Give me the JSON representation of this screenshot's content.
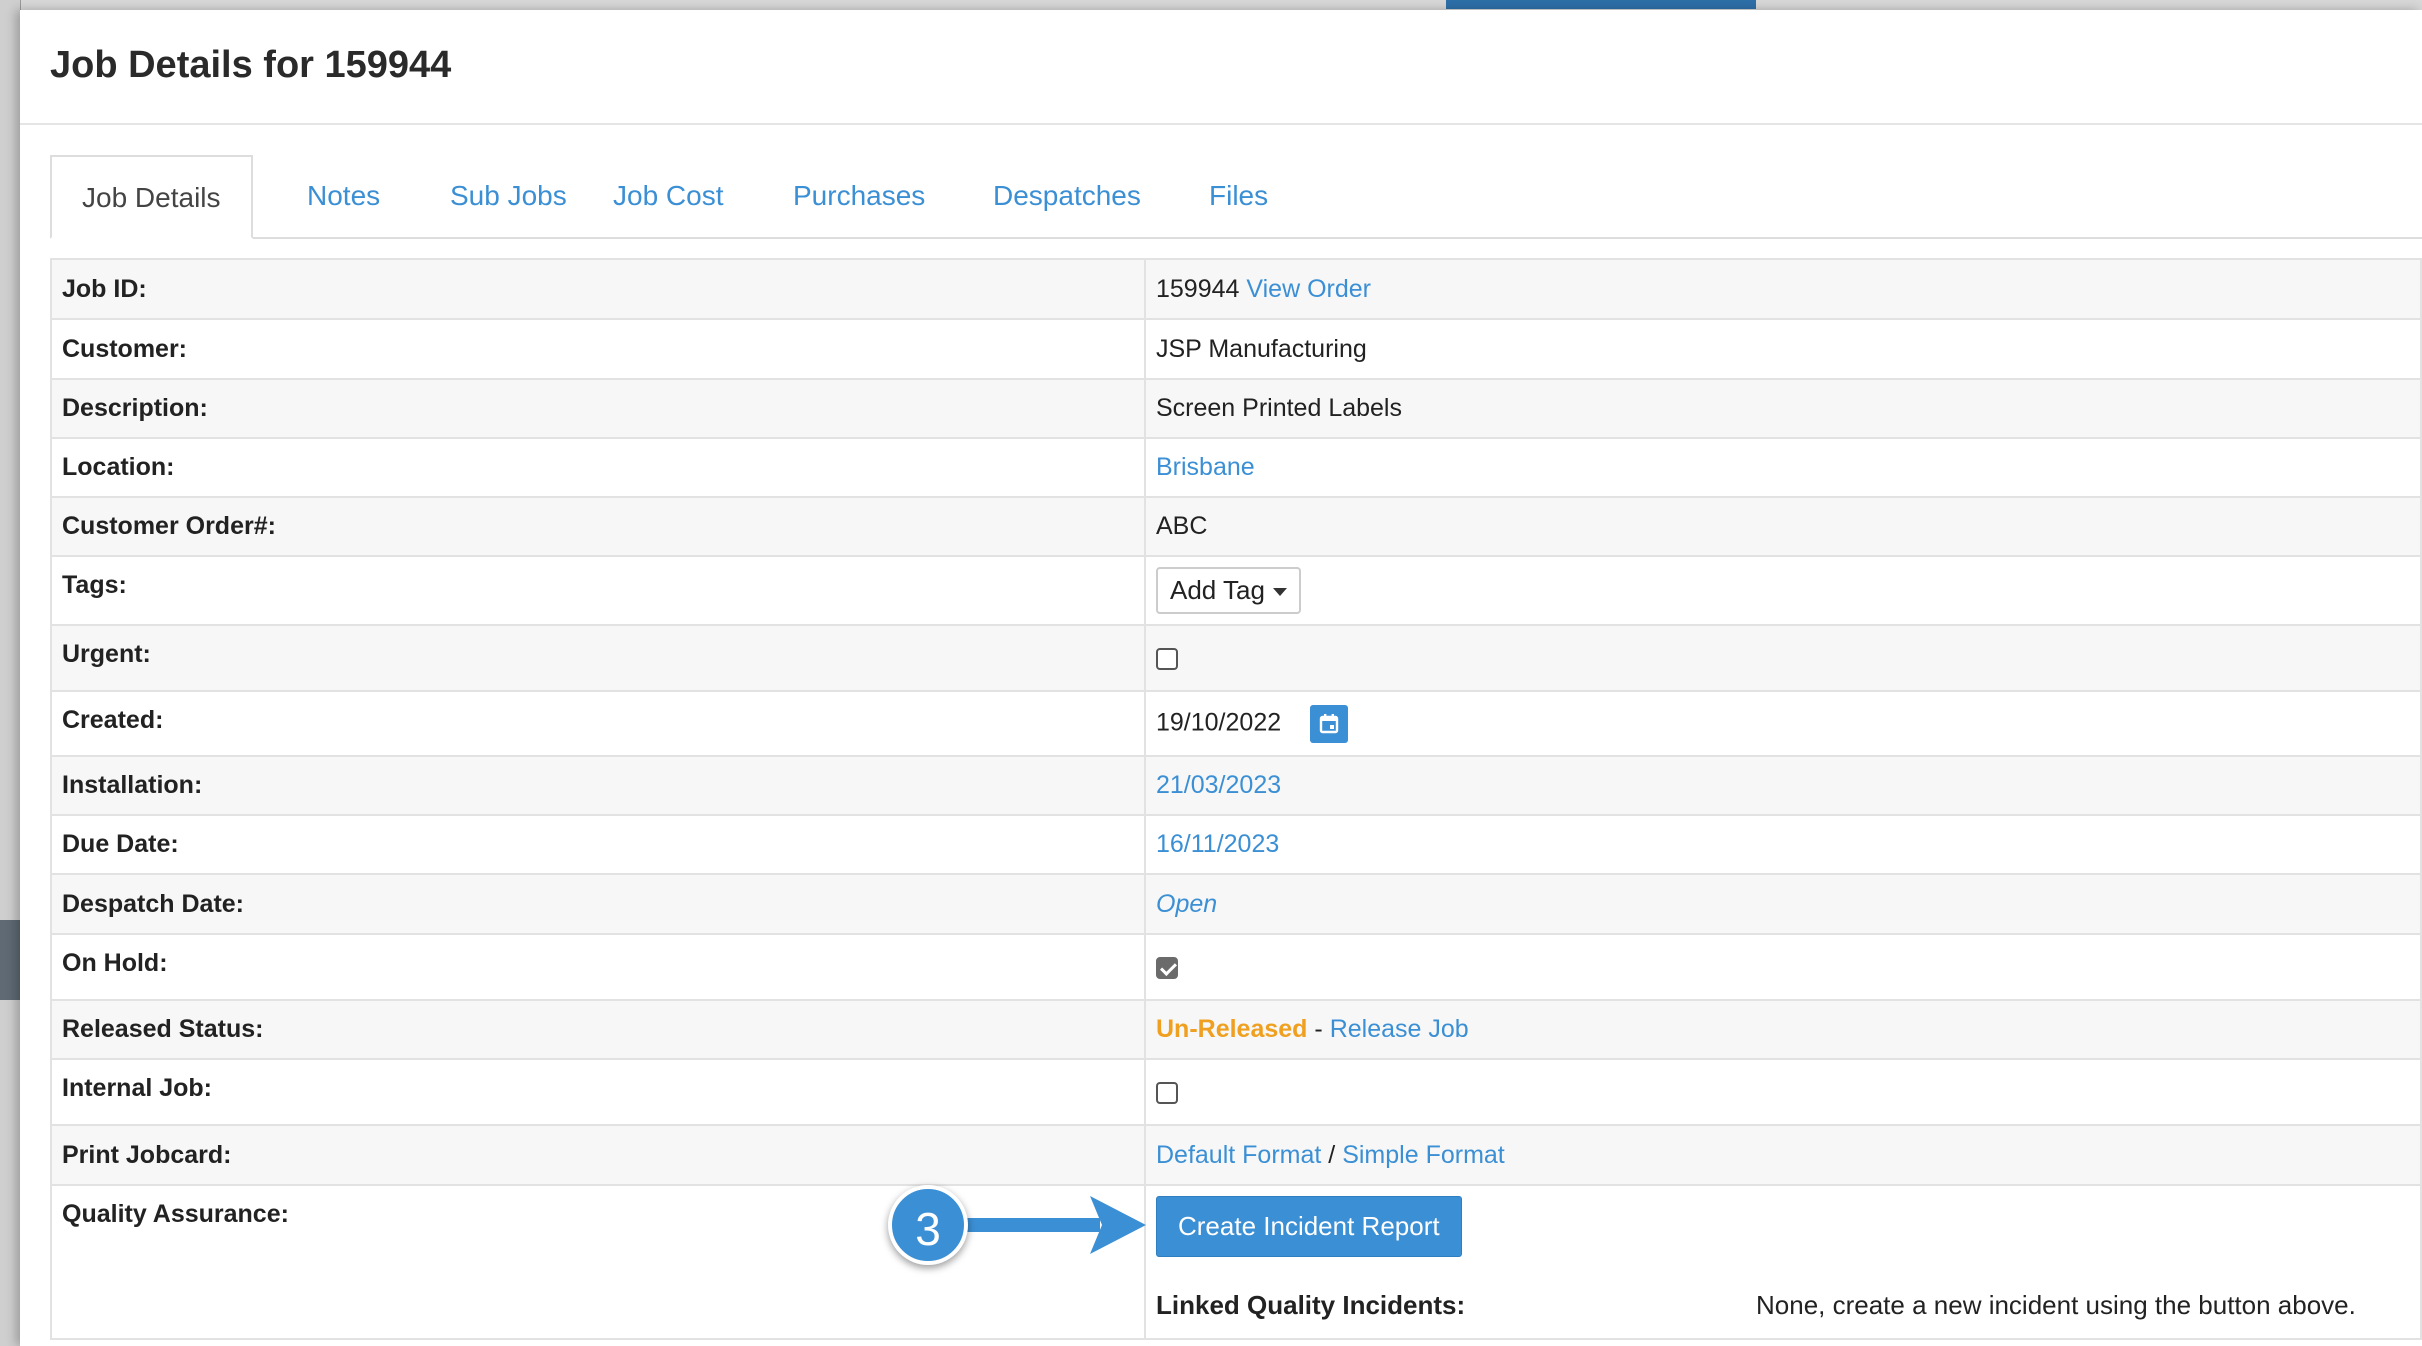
{
  "modal": {
    "title": "Job Details for 159944"
  },
  "tabs": [
    {
      "label": "Job Details",
      "active": true
    },
    {
      "label": "Notes"
    },
    {
      "label": "Sub Jobs"
    },
    {
      "label": "Job Cost"
    },
    {
      "label": "Purchases"
    },
    {
      "label": "Despatches"
    },
    {
      "label": "Files"
    }
  ],
  "fields": {
    "job_id": {
      "label": "Job ID:",
      "value": "159944",
      "link": "View Order"
    },
    "customer": {
      "label": "Customer:",
      "value": "JSP Manufacturing"
    },
    "description": {
      "label": "Description:",
      "value": "Screen Printed Labels"
    },
    "location": {
      "label": "Location:",
      "value": "Brisbane"
    },
    "customer_order": {
      "label": "Customer Order#:",
      "value": "ABC"
    },
    "tags": {
      "label": "Tags:",
      "button": "Add Tag"
    },
    "urgent": {
      "label": "Urgent:",
      "checked": false
    },
    "created": {
      "label": "Created:",
      "value": "19/10/2022"
    },
    "installation": {
      "label": "Installation:",
      "value": "21/03/2023"
    },
    "due_date": {
      "label": "Due Date:",
      "value": "16/11/2023"
    },
    "despatch_date": {
      "label": "Despatch Date:",
      "value": "Open"
    },
    "on_hold": {
      "label": "On Hold:",
      "checked": true
    },
    "released_status": {
      "label": "Released Status:",
      "value": "Un-Released",
      "sep": "-",
      "link": "Release Job"
    },
    "internal_job": {
      "label": "Internal Job:",
      "checked": false
    },
    "print_jobcard": {
      "label": "Print Jobcard:",
      "link1": "Default Format",
      "sep": "/",
      "link2": "Simple Format"
    },
    "quality_assurance": {
      "label": "Quality Assurance:",
      "button": "Create Incident Report",
      "linked_label": "Linked Quality Incidents:",
      "linked_value": "None, create a new incident using the button above."
    }
  },
  "annotation": {
    "number": "3"
  },
  "colors": {
    "link": "#3b8fd4",
    "unreleased": "#f0a020",
    "button": "#3b8fd4"
  }
}
